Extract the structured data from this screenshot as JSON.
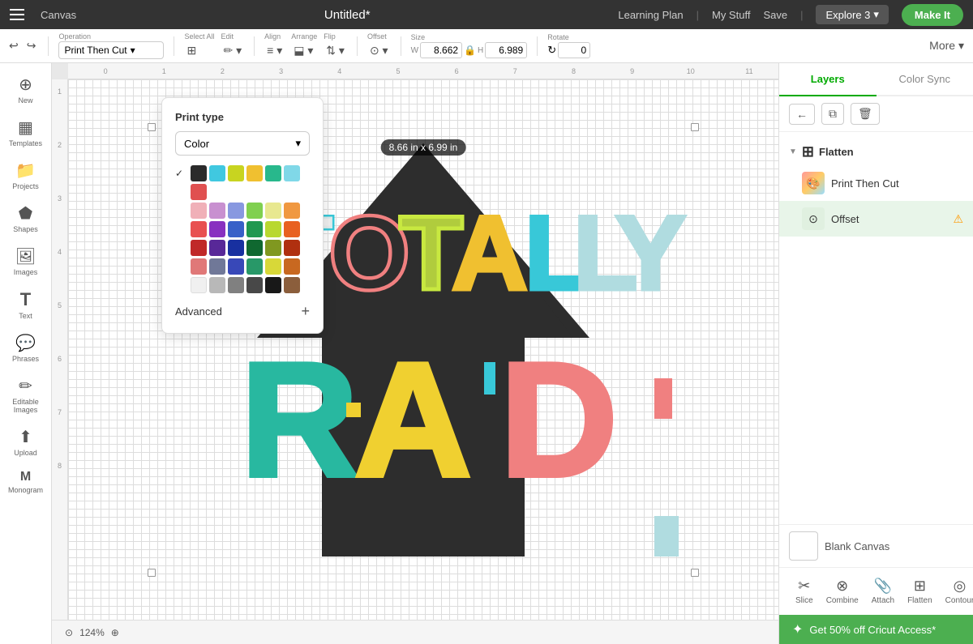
{
  "nav": {
    "hamburger_label": "Menu",
    "canvas_label": "Canvas",
    "title": "Untitled*",
    "learning": "Learning Plan",
    "separator1": "|",
    "mystuff": "My Stuff",
    "save": "Save",
    "separator2": "|",
    "explore": "Explore 3",
    "makeit": "Make It"
  },
  "toolbar": {
    "operation_label": "Operation",
    "operation_value": "Print Then Cut",
    "undo_label": "↩",
    "redo_label": "↪",
    "select_all_label": "Select All",
    "edit_label": "Edit",
    "align_label": "Align",
    "arrange_label": "Arrange",
    "flip_label": "Flip",
    "offset_label": "Offset",
    "size_label": "Size",
    "width_label": "W",
    "width_value": "8.662",
    "height_label": "H",
    "height_value": "6.989",
    "rotate_label": "Rotate",
    "rotate_value": "0",
    "more_label": "More ▾"
  },
  "color_dropdown": {
    "title": "Print type",
    "select_label": "Color",
    "advanced_label": "Advanced",
    "swatches": [
      [
        "#2b2b2b",
        "#40c8e0",
        "#c8d420",
        "#f0c030",
        "#28b88c",
        "#80d8e8"
      ],
      [
        "#e05050"
      ],
      [
        "#f0b0b8",
        "#c890d0",
        "#8898e0",
        "#80d050",
        "#e8e890",
        "#f09840"
      ],
      [
        "#e85050",
        "#8830c0",
        "#3860c8",
        "#209850",
        "#b8d830",
        "#e86020"
      ],
      [
        "#c02828",
        "#582898",
        "#1830a0",
        "#106830",
        "#809820",
        "#b03010"
      ],
      [
        "#e07878",
        "#707898",
        "#3848b8",
        "#289868",
        "#d8d838",
        "#c86820"
      ],
      [
        "#f0f0f0",
        "#b8b8b8",
        "#808080",
        "#484848",
        "#181818",
        "#8b5e3c"
      ]
    ]
  },
  "canvas": {
    "size_badge": "8.66 in x 6.99 in",
    "zoom": "124%"
  },
  "sidebar": {
    "items": [
      {
        "label": "New",
        "icon": "⊕"
      },
      {
        "label": "Templates",
        "icon": "▦"
      },
      {
        "label": "Projects",
        "icon": "📁"
      },
      {
        "label": "Shapes",
        "icon": "⬟"
      },
      {
        "label": "Images",
        "icon": "🖼"
      },
      {
        "label": "Text",
        "icon": "T"
      },
      {
        "label": "Phrases",
        "icon": "💬"
      },
      {
        "label": "Editable Images",
        "icon": "✏"
      },
      {
        "label": "Upload",
        "icon": "⬆"
      },
      {
        "label": "Monogram",
        "icon": "M"
      }
    ]
  },
  "layers": {
    "tab_layers": "Layers",
    "tab_color_sync": "Color Sync",
    "flatten_group": "Flatten",
    "print_then_cut_label": "Print Then Cut",
    "offset_label": "Offset",
    "blank_canvas_label": "Blank Canvas"
  },
  "bottom_tools": [
    {
      "label": "Slice",
      "icon": "✂"
    },
    {
      "label": "Combine",
      "icon": "⊗"
    },
    {
      "label": "Attach",
      "icon": "📎"
    },
    {
      "label": "Flatten",
      "icon": "⊞"
    },
    {
      "label": "Contour",
      "icon": "◎"
    }
  ],
  "promo": {
    "icon": "✦",
    "text": "Get 50% off Cricut Access*"
  }
}
